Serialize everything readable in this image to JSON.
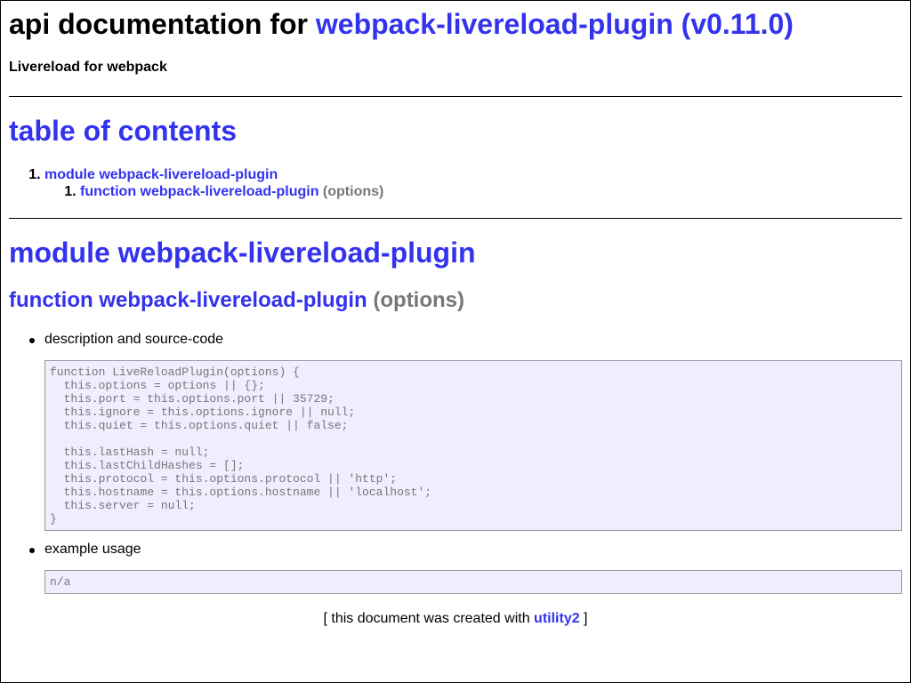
{
  "header": {
    "title_prefix": "api documentation for ",
    "title_link": "webpack-livereload-plugin (v0.11.0)",
    "subtitle": "Livereload for webpack"
  },
  "toc": {
    "heading": "table of contents",
    "items": [
      {
        "number": "1.",
        "label": "module webpack-livereload-plugin",
        "children": [
          {
            "number": "1.",
            "label": "function webpack-livereload-plugin",
            "signature": "(options)"
          }
        ]
      }
    ]
  },
  "module": {
    "heading": "module webpack-livereload-plugin",
    "function": {
      "heading": "function webpack-livereload-plugin",
      "signature": "(options)",
      "description_label": "description and source-code",
      "source_code": "function LiveReloadPlugin(options) {\n  this.options = options || {};\n  this.port = this.options.port || 35729;\n  this.ignore = this.options.ignore || null;\n  this.quiet = this.options.quiet || false;\n\n  this.lastHash = null;\n  this.lastChildHashes = [];\n  this.protocol = this.options.protocol || 'http';\n  this.hostname = this.options.hostname || 'localhost';\n  this.server = null;\n}",
      "example_label": "example usage",
      "example_code": "n/a"
    }
  },
  "footer": {
    "prefix": "[ this document was created with ",
    "link": "utility2",
    "suffix": " ]"
  },
  "colors": {
    "link": "#3333ee",
    "muted": "#777777",
    "code_background": "#eeeeff"
  }
}
